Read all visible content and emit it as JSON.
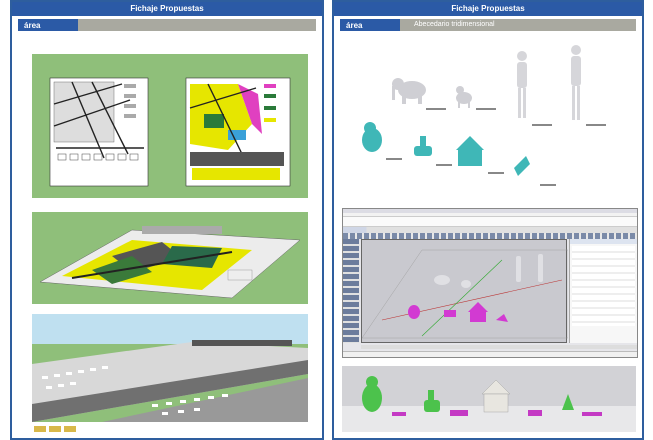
{
  "left": {
    "title": "Fichaje Propuestas",
    "section_tag": "área",
    "section_subtitle": ""
  },
  "right": {
    "title": "Fichaje Propuestas",
    "section_tag": "área",
    "section_subtitle": "Abecedario tridimensional"
  },
  "colors": {
    "header_blue": "#2b5aa6",
    "grass_green": "#8fbf7a",
    "map_yellow": "#e6e600",
    "map_magenta": "#e040c0",
    "teal_model": "#3fb7b7",
    "viewport_gray": "#c9c9cf"
  }
}
